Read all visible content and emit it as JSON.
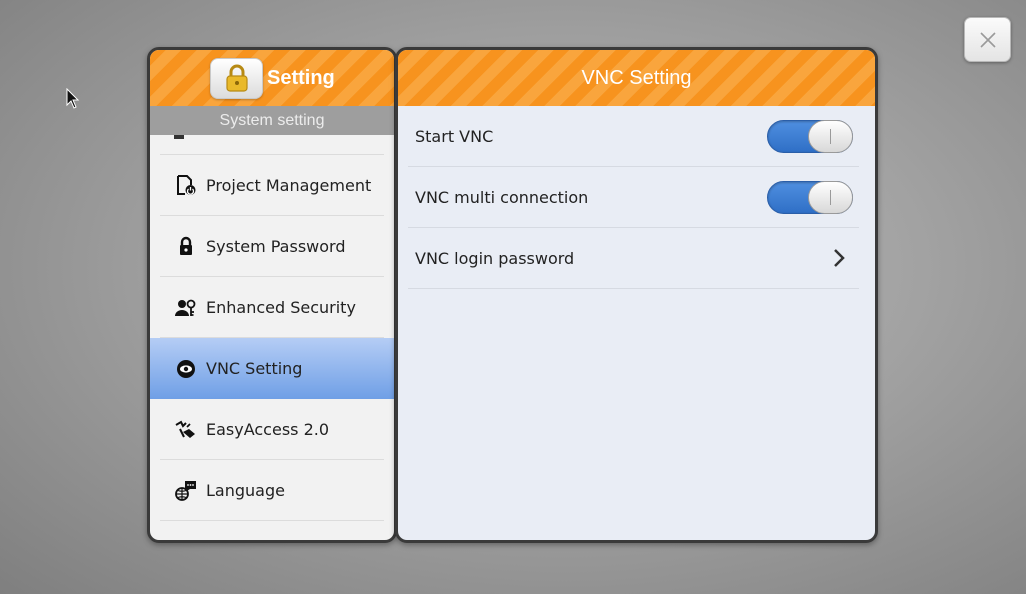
{
  "close_button": {
    "icon": "close-icon"
  },
  "left_panel": {
    "title": "Setting",
    "header_icon": "lock-icon",
    "section_label": "System setting",
    "items": [
      {
        "label": "Project Management",
        "icon": "project-icon",
        "active": false
      },
      {
        "label": "System Password",
        "icon": "lock-icon",
        "active": false
      },
      {
        "label": "Enhanced Security",
        "icon": "users-icon",
        "active": false
      },
      {
        "label": "VNC Setting",
        "icon": "eye-icon",
        "active": true
      },
      {
        "label": "EasyAccess 2.0",
        "icon": "easyaccess-icon",
        "active": false
      },
      {
        "label": "Language",
        "icon": "globe-chat-icon",
        "active": false
      }
    ]
  },
  "right_panel": {
    "title": "VNC Setting",
    "rows": [
      {
        "label": "Start VNC",
        "control": "toggle",
        "on": true
      },
      {
        "label": "VNC multi connection",
        "control": "toggle",
        "on": true
      },
      {
        "label": "VNC login password",
        "control": "chevron"
      }
    ]
  },
  "colors": {
    "header_orange": "#f7931e",
    "active_blue": "#6f9fe6",
    "toggle_blue": "#2f6fc6"
  }
}
